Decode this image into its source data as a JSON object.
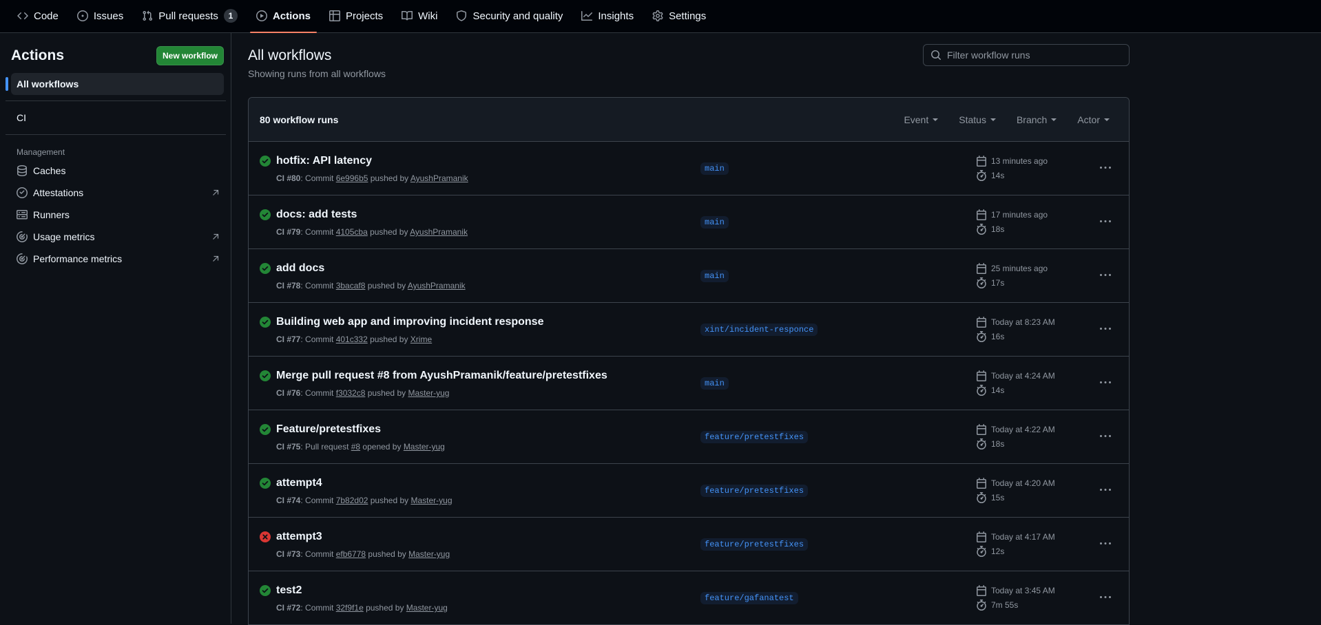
{
  "nav": {
    "tabs": [
      {
        "label": "Code",
        "icon": "code-icon"
      },
      {
        "label": "Issues",
        "icon": "issue-icon"
      },
      {
        "label": "Pull requests",
        "icon": "pull-request-icon",
        "count": "1"
      },
      {
        "label": "Actions",
        "icon": "play-icon",
        "active": true
      },
      {
        "label": "Projects",
        "icon": "table-icon"
      },
      {
        "label": "Wiki",
        "icon": "book-icon"
      },
      {
        "label": "Security and quality",
        "icon": "shield-icon"
      },
      {
        "label": "Insights",
        "icon": "graph-icon"
      },
      {
        "label": "Settings",
        "icon": "gear-icon"
      }
    ]
  },
  "sidebar": {
    "title": "Actions",
    "new_workflow_label": "New workflow",
    "all_workflows_label": "All workflows",
    "workflow_ci_label": "CI",
    "management_heading": "Management",
    "management_items": [
      {
        "label": "Caches",
        "icon": "database-icon"
      },
      {
        "label": "Attestations",
        "icon": "verified-icon",
        "external": true
      },
      {
        "label": "Runners",
        "icon": "server-icon"
      },
      {
        "label": "Usage metrics",
        "icon": "meter-icon",
        "external": true
      },
      {
        "label": "Performance metrics",
        "icon": "meter-icon",
        "external": true
      }
    ]
  },
  "main": {
    "title": "All workflows",
    "subtitle": "Showing runs from all workflows",
    "search_placeholder": "Filter workflow runs",
    "run_count_label": "80 workflow runs",
    "filters": [
      "Event",
      "Status",
      "Branch",
      "Actor"
    ],
    "colors": {
      "success": "#238636",
      "failure": "#da3633",
      "branch_text": "#4493f8"
    },
    "runs": [
      {
        "status": "success",
        "title": "hotfix: API latency",
        "workflow": "CI #80",
        "verb": ": Commit ",
        "ref": "6e996b5",
        "action": " pushed by ",
        "actor": "AyushPramanik",
        "branch": "main",
        "time": "13 minutes ago",
        "duration": "14s"
      },
      {
        "status": "success",
        "title": "docs: add tests",
        "workflow": "CI #79",
        "verb": ": Commit ",
        "ref": "4105cba",
        "action": " pushed by ",
        "actor": "AyushPramanik",
        "branch": "main",
        "time": "17 minutes ago",
        "duration": "18s"
      },
      {
        "status": "success",
        "title": "add docs",
        "workflow": "CI #78",
        "verb": ": Commit ",
        "ref": "3bacaf8",
        "action": " pushed by ",
        "actor": "AyushPramanik",
        "branch": "main",
        "time": "25 minutes ago",
        "duration": "17s"
      },
      {
        "status": "success",
        "title": "Building web app and improving incident response",
        "workflow": "CI #77",
        "verb": ": Commit ",
        "ref": "401c332",
        "action": " pushed by ",
        "actor": "Xrime",
        "branch": "xint/incident-responce",
        "time": "Today at 8:23 AM",
        "duration": "16s"
      },
      {
        "status": "success",
        "title": "Merge pull request #8 from AyushPramanik/feature/pretestfixes",
        "workflow": "CI #76",
        "verb": ": Commit ",
        "ref": "f3032c8",
        "action": " pushed by ",
        "actor": "Master-yug",
        "branch": "main",
        "time": "Today at 4:24 AM",
        "duration": "14s"
      },
      {
        "status": "success",
        "title": "Feature/pretestfixes",
        "workflow": "CI #75",
        "verb": ": Pull request ",
        "ref": "#8",
        "action": " opened by ",
        "actor": "Master-yug",
        "branch": "feature/pretestfixes",
        "time": "Today at 4:22 AM",
        "duration": "18s"
      },
      {
        "status": "success",
        "title": "attempt4",
        "workflow": "CI #74",
        "verb": ": Commit ",
        "ref": "7b82d02",
        "action": " pushed by ",
        "actor": "Master-yug",
        "branch": "feature/pretestfixes",
        "time": "Today at 4:20 AM",
        "duration": "15s"
      },
      {
        "status": "failure",
        "title": "attempt3",
        "workflow": "CI #73",
        "verb": ": Commit ",
        "ref": "efb6778",
        "action": " pushed by ",
        "actor": "Master-yug",
        "branch": "feature/pretestfixes",
        "time": "Today at 4:17 AM",
        "duration": "12s"
      },
      {
        "status": "success",
        "title": "test2",
        "workflow": "CI #72",
        "verb": ": Commit ",
        "ref": "32f9f1e",
        "action": " pushed by ",
        "actor": "Master-yug",
        "branch": "feature/gafanatest",
        "time": "Today at 3:45 AM",
        "duration": "7m 55s"
      }
    ]
  }
}
